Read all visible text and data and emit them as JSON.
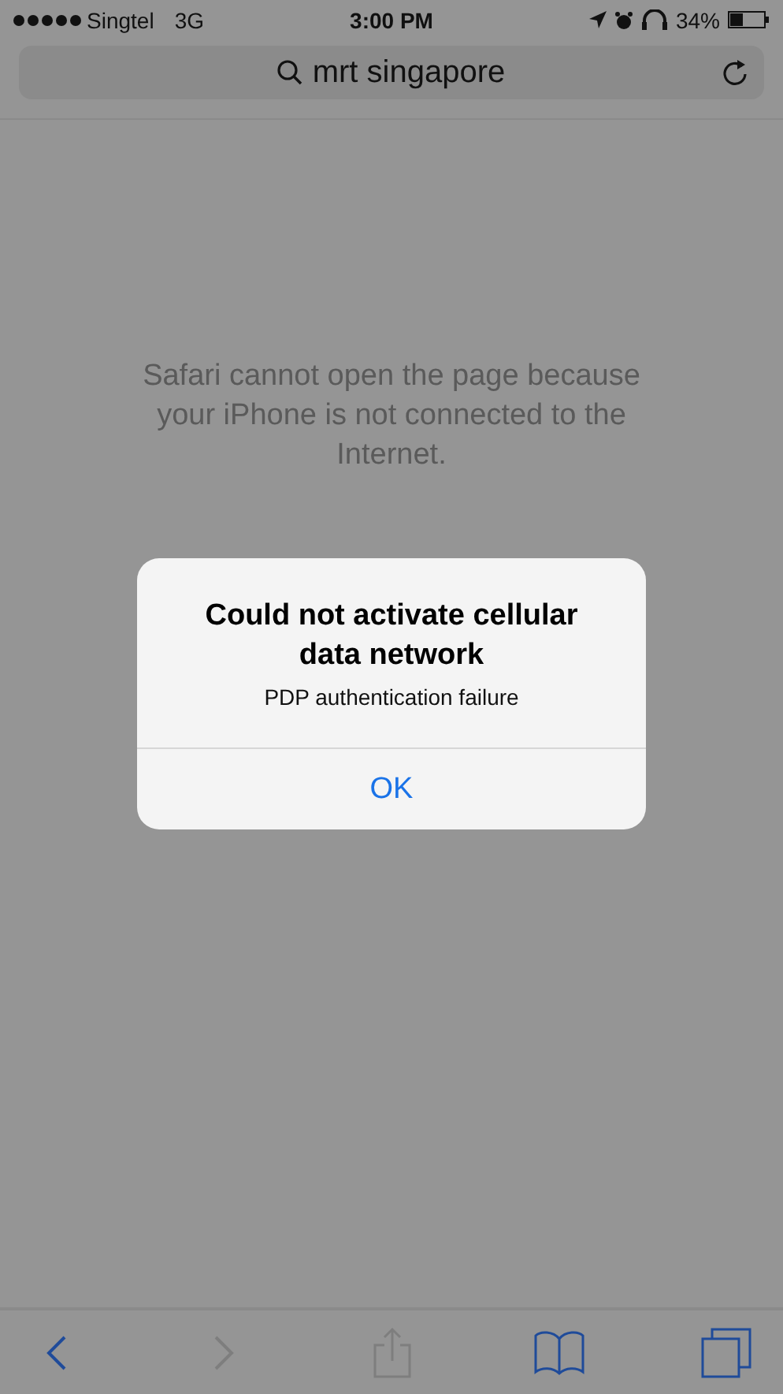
{
  "status_bar": {
    "carrier": "Singtel",
    "network": "3G",
    "time": "3:00 PM",
    "battery": "34%"
  },
  "address_bar": {
    "value": "mrt singapore"
  },
  "message": "Safari cannot open the page because your iPhone is not connected to the Internet.",
  "alert": {
    "title": "Could not activate cellular data network",
    "message": "PDP authentication failure",
    "buttons": [
      "OK"
    ]
  },
  "toolbar": [
    {
      "kind": "back",
      "disabled": false
    },
    {
      "kind": "forward",
      "disabled": true
    },
    {
      "kind": "share",
      "disabled": true
    },
    {
      "kind": "bookmarks",
      "disabled": false
    },
    {
      "kind": "tabs",
      "disabled": false
    }
  ]
}
